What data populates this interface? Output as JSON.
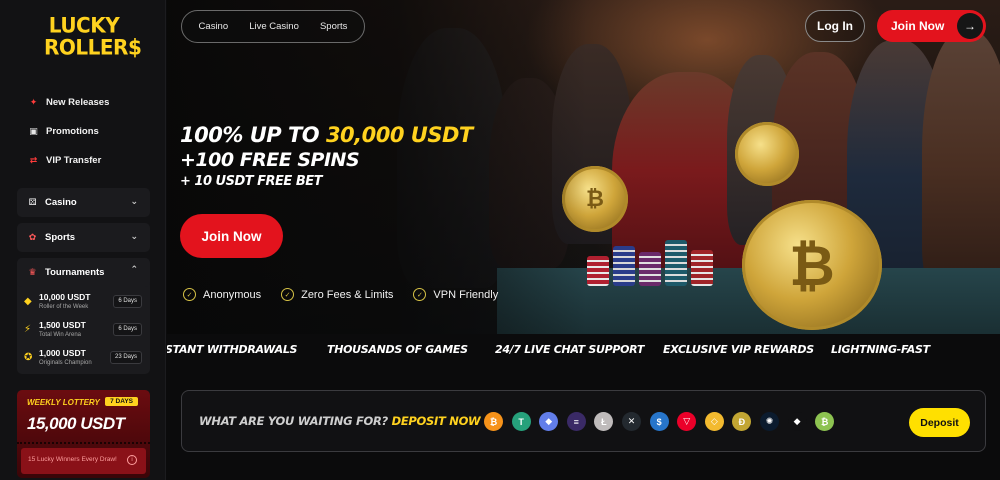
{
  "logo": {
    "line1": "LUCKY",
    "line2": "ROLLER$"
  },
  "sidebar": {
    "top_items": [
      {
        "label": "New Releases",
        "icon": "sparkle-icon"
      },
      {
        "label": "Promotions",
        "icon": "gift-icon"
      },
      {
        "label": "VIP Transfer",
        "icon": "transfer-icon"
      }
    ],
    "groups": [
      {
        "label": "Casino",
        "icon": "dice-icon"
      },
      {
        "label": "Sports",
        "icon": "ball-icon"
      },
      {
        "label": "Tournaments",
        "icon": "trophy-icon"
      }
    ],
    "tournaments": [
      {
        "amount": "10,000 USDT",
        "name": "Roller of the Week",
        "days": "6 Days"
      },
      {
        "amount": "1,500 USDT",
        "name": "Total Win Arena",
        "days": "6 Days"
      },
      {
        "amount": "1,000 USDT",
        "name": "Originals Champion",
        "days": "23 Days"
      }
    ],
    "lottery": {
      "title": "WEEKLY LOTTERY",
      "days": "7 DAYS",
      "amount": "15,000 USDT",
      "footer": "15 Lucky Winners Every Draw!"
    }
  },
  "header": {
    "nav": [
      "Casino",
      "Live Casino",
      "Sports"
    ],
    "login": "Log In",
    "join": "Join Now"
  },
  "hero": {
    "promo_a": "100% UP TO ",
    "promo_b": "30,000 USDT",
    "promo_line2": "+100 FREE SPINS",
    "promo_line3": "+ 10 USDT FREE BET",
    "cta": "Join Now",
    "features": [
      "Anonymous",
      "Zero Fees & Limits",
      "VPN Friendly"
    ]
  },
  "ticker": [
    "STANT WITHDRAWALS",
    "THOUSANDS OF GAMES",
    "24/7 LIVE CHAT SUPPORT",
    "EXCLUSIVE VIP REWARDS",
    "LIGHTNING-FAST"
  ],
  "deposit_bar": {
    "question": "WHAT ARE YOU WAITING FOR? ",
    "highlight": "DEPOSIT NOW",
    "button": "Deposit",
    "coins": [
      {
        "name": "bitcoin-icon",
        "glyph": "₿",
        "color": "#f7931a"
      },
      {
        "name": "tether-icon",
        "glyph": "T",
        "color": "#26a17b"
      },
      {
        "name": "ethereum-icon",
        "glyph": "◆",
        "color": "#627eea"
      },
      {
        "name": "solana-icon",
        "glyph": "≡",
        "color": "#3a2a66"
      },
      {
        "name": "litecoin-icon",
        "glyph": "Ł",
        "color": "#bfbbbb"
      },
      {
        "name": "xrp-icon",
        "glyph": "✕",
        "color": "#23292f"
      },
      {
        "name": "usdc-icon",
        "glyph": "$",
        "color": "#2775ca"
      },
      {
        "name": "tron-icon",
        "glyph": "▽",
        "color": "#eb0029"
      },
      {
        "name": "bnb-icon",
        "glyph": "◇",
        "color": "#f3ba2f"
      },
      {
        "name": "dogecoin-icon",
        "glyph": "Ð",
        "color": "#c2a633"
      },
      {
        "name": "cardano-icon",
        "glyph": "✺",
        "color": "#0b1b2e"
      },
      {
        "name": "diamond-icon",
        "glyph": "◆",
        "color": "#111113"
      },
      {
        "name": "bitcoin-cash-icon",
        "glyph": "₿",
        "color": "#8dc351"
      }
    ]
  }
}
